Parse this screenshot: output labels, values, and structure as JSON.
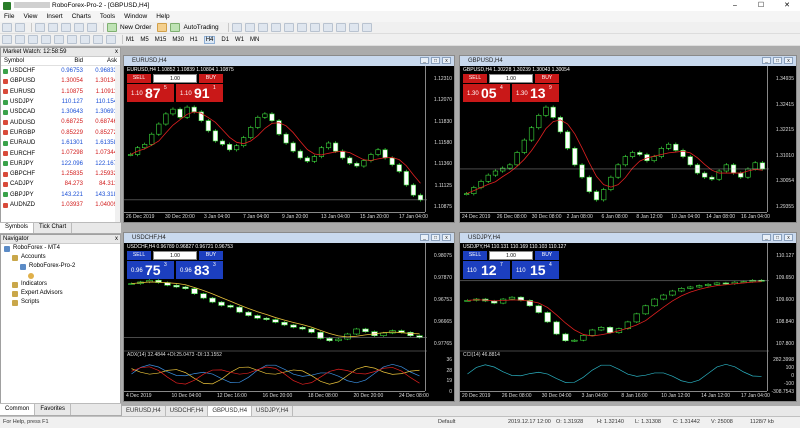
{
  "window": {
    "title": "RoboForex-Pro-2 - [GBPUSD,H4]",
    "minimize": "–",
    "maximize": "☐",
    "close": "✕"
  },
  "menu": [
    "File",
    "View",
    "Insert",
    "Charts",
    "Tools",
    "Window",
    "Help"
  ],
  "toolbar": {
    "new_order": "New Order",
    "autotrading": "AutoTrading"
  },
  "timeframes": [
    "M1",
    "M5",
    "M15",
    "M30",
    "H1",
    "H4",
    "D1",
    "W1",
    "MN"
  ],
  "active_timeframe": "H4",
  "market_watch": {
    "title": "Market Watch: 12:58:59",
    "close": "x",
    "columns": [
      "Symbol",
      "Bid",
      "Ask"
    ],
    "rows": [
      {
        "symbol": "USDCHF",
        "bid": "0.96753",
        "ask": "0.96833",
        "dir": "up"
      },
      {
        "symbol": "GBPUSD",
        "bid": "1.30054",
        "ask": "1.30134",
        "dir": "dn"
      },
      {
        "symbol": "EURUSD",
        "bid": "1.10875",
        "ask": "1.10911",
        "dir": "dn"
      },
      {
        "symbol": "USDJPY",
        "bid": "110.127",
        "ask": "110.154",
        "dir": "up"
      },
      {
        "symbol": "USDCAD",
        "bid": "1.30643",
        "ask": "1.30691",
        "dir": "up"
      },
      {
        "symbol": "AUDUSD",
        "bid": "0.68725",
        "ask": "0.68746",
        "dir": "dn"
      },
      {
        "symbol": "EURGBP",
        "bid": "0.85229",
        "ask": "0.85272",
        "dir": "dn"
      },
      {
        "symbol": "EURAUD",
        "bid": "1.61301",
        "ask": "1.61358",
        "dir": "up"
      },
      {
        "symbol": "EURCHF",
        "bid": "1.07298",
        "ask": "1.07344",
        "dir": "dn"
      },
      {
        "symbol": "EURJPY",
        "bid": "122.096",
        "ask": "122.167",
        "dir": "up"
      },
      {
        "symbol": "GBPCHF",
        "bid": "1.25835",
        "ask": "1.25932",
        "dir": "dn"
      },
      {
        "symbol": "CADJPY",
        "bid": "84.273",
        "ask": "84.311",
        "dir": "dn"
      },
      {
        "symbol": "GBPJPY",
        "bid": "143.221",
        "ask": "143.318",
        "dir": "up"
      },
      {
        "symbol": "AUDNZD",
        "bid": "1.03937",
        "ask": "1.04009",
        "dir": "dn"
      }
    ],
    "tabs": [
      "Symbols",
      "Tick Chart"
    ]
  },
  "navigator": {
    "title": "Navigator",
    "close": "x",
    "items": [
      {
        "label": "RoboForex - MT4",
        "indent": 0,
        "icon": "pc"
      },
      {
        "label": "Accounts",
        "indent": 1,
        "icon": "folder"
      },
      {
        "label": "RoboForex-Pro-2",
        "indent": 2,
        "icon": "pc"
      },
      {
        "label": "",
        "indent": 3,
        "icon": "user"
      },
      {
        "label": "Indicators",
        "indent": 1,
        "icon": "folder"
      },
      {
        "label": "Expert Advisors",
        "indent": 1,
        "icon": "folder"
      },
      {
        "label": "Scripts",
        "indent": 1,
        "icon": "folder"
      }
    ],
    "tabs": [
      "Common",
      "Favorites"
    ]
  },
  "charts": [
    {
      "title": "EURUSD,H4",
      "info": "EURUSD,H4  1.10852 1.10839 1.10804 1.10875",
      "theme": "red",
      "trade": {
        "sell": "SELL",
        "buy": "BUY",
        "lot": "1.00",
        "sell_small": "1.10",
        "sell_big": "87",
        "sell_sup": "5",
        "buy_small": "1.10",
        "buy_big": "91",
        "buy_sup": "1"
      },
      "yticks": [
        "1.12310",
        "1.12070",
        "1.11830",
        "1.11580",
        "1.11360",
        "1.11125",
        "1.10875"
      ],
      "xticks": [
        "26 Dec 2019",
        "30 Dec 20:00",
        "3 Jan 04:00",
        "7 Jan 04:00",
        "9 Jan 20:00",
        "13 Jan 04:00",
        "15 Jan 20:00",
        "17 Jan 04:00"
      ],
      "current_price": "1.10875",
      "closes": [
        1.1155,
        1.1165,
        1.117,
        1.1185,
        1.12,
        1.1215,
        1.1222,
        1.121,
        1.1225,
        1.1218,
        1.1205,
        1.119,
        1.1175,
        1.117,
        1.1162,
        1.1168,
        1.118,
        1.1195,
        1.121,
        1.1215,
        1.1205,
        1.1185,
        1.1172,
        1.116,
        1.115,
        1.1145,
        1.1152,
        1.1165,
        1.1172,
        1.116,
        1.115,
        1.1142,
        1.1138,
        1.1146,
        1.1155,
        1.1162,
        1.115,
        1.114,
        1.113,
        1.111,
        1.1095,
        1.1088
      ]
    },
    {
      "title": "GBPUSD,H4",
      "info": "GBPUSD,H4  1.30228 1.30239 1.30043 1.30054",
      "theme": "red",
      "trade": {
        "sell": "SELL",
        "buy": "BUY",
        "lot": "1.00",
        "sell_small": "1.30",
        "sell_big": "05",
        "sell_sup": "4",
        "buy_small": "1.30",
        "buy_big": "13",
        "buy_sup": "9"
      },
      "yticks": [
        "1.34935",
        "1.32415",
        "1.32215",
        "1.31010",
        "1.30054",
        "1.29355"
      ],
      "xticks": [
        "24 Dec 2019",
        "26 Dec 08:00",
        "30 Dec 08:00",
        "2 Jan 08:00",
        "6 Jan 08:00",
        "8 Jan 12:00",
        "10 Jan 04:00",
        "14 Jan 08:00",
        "16 Jan 04:00"
      ],
      "current_price": "1.30054",
      "closes": [
        1.299,
        1.3005,
        1.302,
        1.3035,
        1.3045,
        1.3052,
        1.306,
        1.309,
        1.312,
        1.315,
        1.318,
        1.32,
        1.3175,
        1.314,
        1.31,
        1.306,
        1.303,
        1.2995,
        1.2975,
        1.3,
        1.303,
        1.306,
        1.308,
        1.309,
        1.3085,
        1.307,
        1.308,
        1.31,
        1.311,
        1.3095,
        1.308,
        1.306,
        1.304,
        1.303,
        1.3025,
        1.3045,
        1.306,
        1.304,
        1.303,
        1.305,
        1.3065,
        1.305
      ]
    },
    {
      "title": "USDCHF,H4",
      "info": "USDCHF,H4  0.96789 0.96827 0.96721 0.96753",
      "theme": "blue",
      "trade": {
        "sell": "SELL",
        "buy": "BUY",
        "lot": "1.00",
        "sell_small": "0.96",
        "sell_big": "75",
        "sell_sup": "3",
        "buy_small": "0.96",
        "buy_big": "83",
        "buy_sup": "3"
      },
      "yticks": [
        "0.98075",
        "0.97870",
        "0.96753",
        "0.96665",
        "0.97765"
      ],
      "xticks": [
        "4 Dec 2019",
        "10 Dec 04:00",
        "12 Dec 16:00",
        "16 Dec 20:00",
        "18 Dec 08:00",
        "20 Dec 20:00",
        "24 Dec 08:00"
      ],
      "current_price": "0.96753",
      "indicator_label": "ADX(14) 32.4844 +DI:25.0473 -DI:13.1552",
      "indicator_ticks": [
        "36",
        "28",
        "19",
        "0"
      ],
      "closes": [
        0.9835,
        0.984,
        0.9845,
        0.9838,
        0.983,
        0.9825,
        0.982,
        0.9805,
        0.9792,
        0.978,
        0.977,
        0.9765,
        0.975,
        0.974,
        0.9732,
        0.9728,
        0.972,
        0.9712,
        0.9705,
        0.97,
        0.969,
        0.9672,
        0.9665,
        0.967,
        0.9685,
        0.97,
        0.9692,
        0.968,
        0.9688,
        0.9695,
        0.969,
        0.968,
        0.9675
      ]
    },
    {
      "title": "USDJPY,H4",
      "info": "USDJPY,H4  110.131 110.169 110.103 110.127",
      "theme": "blue",
      "trade": {
        "sell": "SELL",
        "buy": "BUY",
        "lot": "1.00",
        "sell_small": "110",
        "sell_big": "12",
        "sell_sup": "7",
        "buy_small": "110",
        "buy_big": "15",
        "buy_sup": "4"
      },
      "yticks": [
        "110.127",
        "109.650",
        "109.600",
        "108.840",
        "107.800"
      ],
      "xticks": [
        "20 Dec 2019",
        "26 Dec 08:00",
        "30 Dec 04:00",
        "3 Jan 04:00",
        "8 Jan 16:00",
        "10 Jan 12:00",
        "14 Jan 12:00",
        "17 Jan 04:00"
      ],
      "current_price": "110.127",
      "indicator_label": "CCI(14) 46.8814",
      "indicator_ticks": [
        "282.3998",
        "100",
        "0",
        "-100",
        "-308.7543"
      ],
      "closes": [
        109.4,
        109.45,
        109.38,
        109.3,
        109.45,
        109.52,
        109.4,
        109.2,
        108.95,
        108.6,
        108.15,
        107.9,
        107.92,
        108.1,
        108.3,
        108.4,
        108.2,
        108.35,
        108.6,
        108.9,
        109.2,
        109.45,
        109.6,
        109.75,
        109.85,
        109.9,
        109.95,
        110.0,
        110.05,
        110.02,
        110.08,
        110.1,
        110.15,
        110.13
      ]
    }
  ],
  "chart_tabs": [
    "EURUSD,H4",
    "USDCHF,H4",
    "GBPUSD,H4",
    "USDJPY,H4"
  ],
  "active_chart_tab": "GBPUSD,H4",
  "status": {
    "help": "For Help, press F1",
    "profile": "Default",
    "datetime": "2019.12.17 12:00",
    "open": "O: 1.31928",
    "high": "H: 1.32140",
    "low": "L: 1.31308",
    "close": "C: 1.31442",
    "volume": "V: 25008",
    "traffic": "1128/7 kb"
  }
}
